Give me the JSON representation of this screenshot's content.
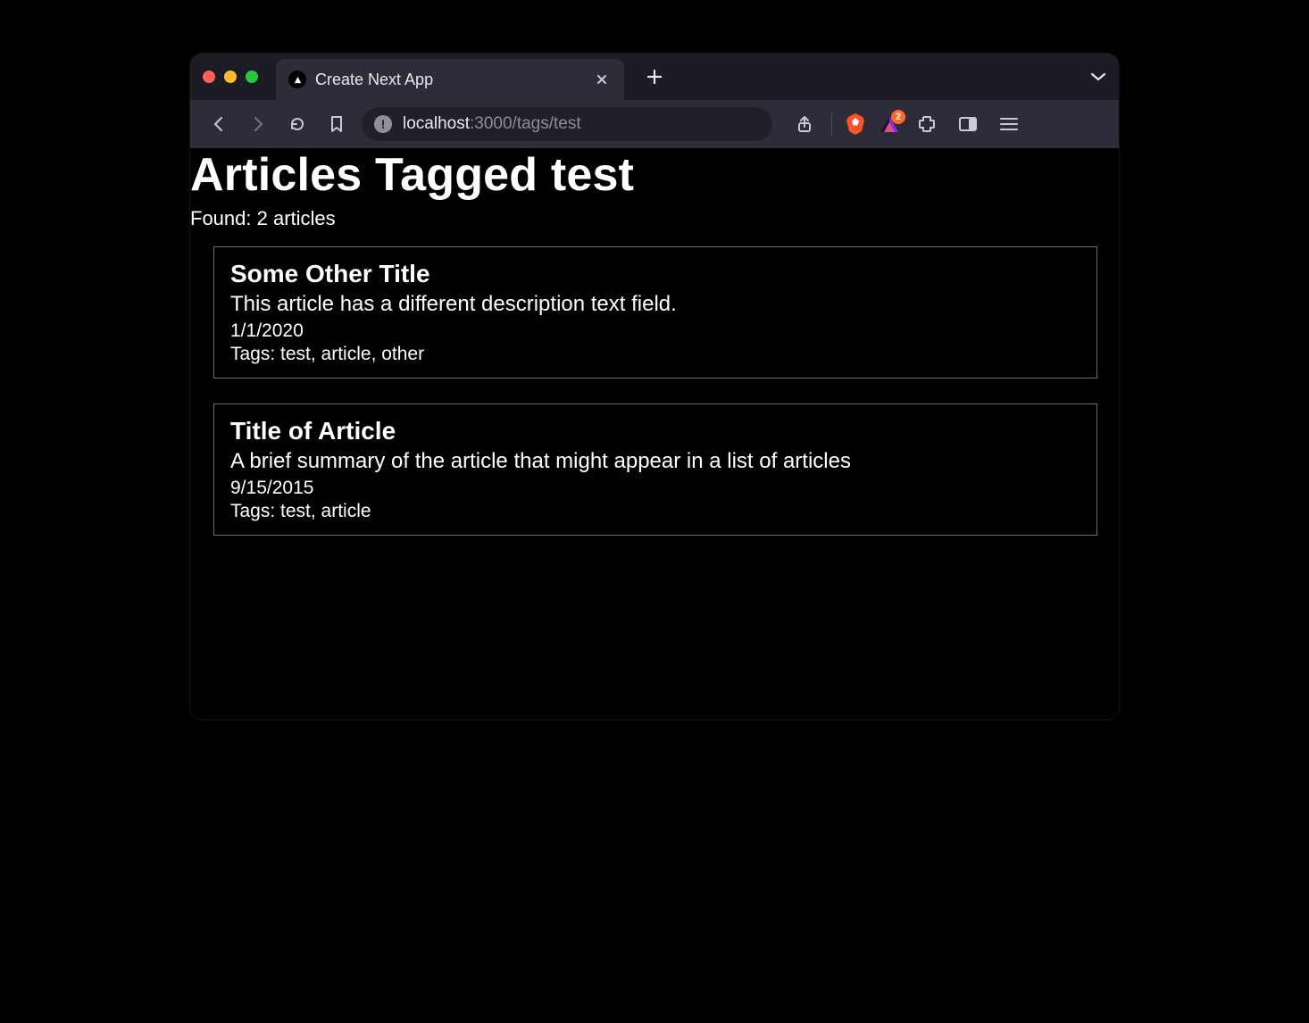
{
  "browser": {
    "tab_title": "Create Next App",
    "url_host": "localhost",
    "url_path": ":3000/tags/test",
    "badge_count": "2"
  },
  "page": {
    "heading": "Articles Tagged test",
    "found_text": "Found: 2 articles",
    "tags_label": "Tags: "
  },
  "articles": [
    {
      "title": "Some Other Title",
      "description": "This article has a different description text field.",
      "date": "1/1/2020",
      "tags_line": "test, article, other"
    },
    {
      "title": "Title of Article",
      "description": "A brief summary of the article that might appear in a list of articles",
      "date": "9/15/2015",
      "tags_line": "test, article"
    }
  ]
}
